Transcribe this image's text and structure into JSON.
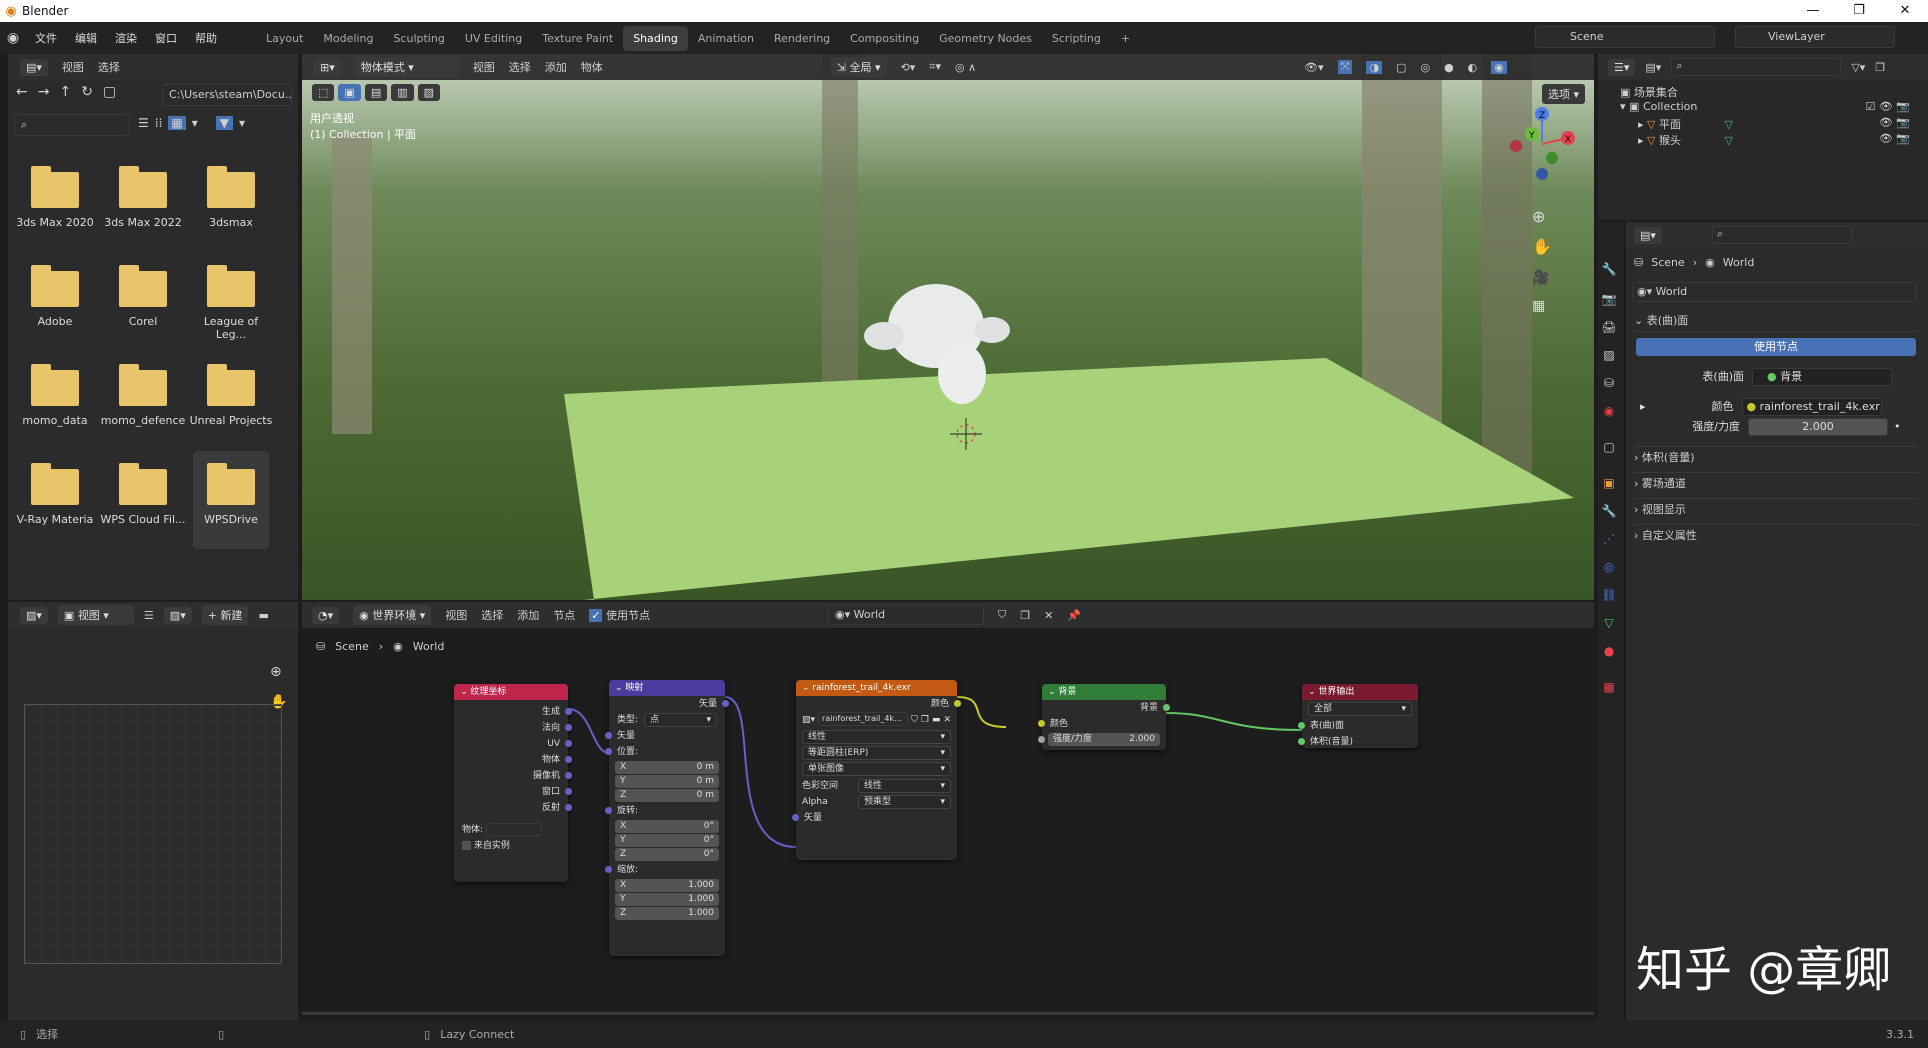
{
  "app": {
    "title": "Blender",
    "version": "3.3.1"
  },
  "window_controls": {
    "min": "—",
    "max": "❐",
    "close": "✕"
  },
  "menu": [
    "文件",
    "编辑",
    "渲染",
    "窗口",
    "帮助"
  ],
  "workspaces": [
    "Layout",
    "Modeling",
    "Sculpting",
    "UV Editing",
    "Texture Paint",
    "Shading",
    "Animation",
    "Rendering",
    "Compositing",
    "Geometry Nodes",
    "Scripting"
  ],
  "active_workspace": "Shading",
  "scene": {
    "name": "Scene",
    "view_layer": "ViewLayer"
  },
  "file_browser": {
    "header": {
      "view": "视图",
      "select": "选择"
    },
    "path": "C:\\Users\\steam\\Docu...",
    "folders": [
      "3ds Max 2020",
      "3ds Max 2022",
      "3dsmax",
      "Adobe",
      "Corel",
      "League of Leg...",
      "momo_data",
      "momo_defence",
      "Unreal Projects",
      "V-Ray Materia",
      "WPS Cloud Fil...",
      "WPSDrive"
    ]
  },
  "viewport": {
    "mode": "物体模式",
    "menus": [
      "视图",
      "选择",
      "添加",
      "物体"
    ],
    "transform": "全局",
    "options": "选项",
    "overlay_title": "用户透视",
    "overlay_sub": "(1) Collection | 平面"
  },
  "outliner": {
    "root": "场景集合",
    "collection": "Collection",
    "items": [
      "平面",
      "猴头"
    ]
  },
  "properties": {
    "breadcrumb": [
      "Scene",
      "World"
    ],
    "world_name": "World",
    "surface_panel": "表(曲)面",
    "use_nodes": "使用节点",
    "surface_label": "表(曲)面",
    "surface_value": "背景",
    "color_label": "颜色",
    "color_value": "rainforest_trail_4k.exr",
    "strength_label": "强度/力度",
    "strength_value": "2.000",
    "panels": [
      "体积(音量)",
      "雾场通道",
      "视图显示",
      "自定义属性"
    ]
  },
  "image_editor": {
    "view": "视图",
    "new": "新建"
  },
  "node_editor": {
    "type": "世界环境",
    "menus": [
      "视图",
      "选择",
      "添加",
      "节点"
    ],
    "use_nodes": "使用节点",
    "world": "World",
    "breadcrumb": [
      "Scene",
      "World"
    ],
    "nodes": {
      "texcoord": {
        "title": "纹理坐标",
        "outputs": [
          "生成",
          "法向",
          "UV",
          "物体",
          "摄像机",
          "窗口",
          "反射"
        ],
        "object_label": "物体:",
        "from_instancer": "来自实例"
      },
      "mapping": {
        "title": "映射",
        "output": "矢量",
        "type_label": "类型:",
        "type_value": "点",
        "vector": "矢量",
        "location": "位置:",
        "rotation": "旋转:",
        "scale": "缩放:",
        "loc": [
          [
            "X",
            "0 m"
          ],
          [
            "Y",
            "0 m"
          ],
          [
            "Z",
            "0 m"
          ]
        ],
        "rot": [
          [
            "X",
            "0°"
          ],
          [
            "Y",
            "0°"
          ],
          [
            "Z",
            "0°"
          ]
        ],
        "scl": [
          [
            "X",
            "1.000"
          ],
          [
            "Y",
            "1.000"
          ],
          [
            "Z",
            "1.000"
          ]
        ]
      },
      "envtex": {
        "title": "rainforest_trail_4k.exr",
        "output": "颜色",
        "image": "rainforest_trail_4k...",
        "interp": "线性",
        "projection": "等距圆柱(ERP)",
        "source": "单张图像",
        "cs_label": "色彩空间",
        "cs_value": "线性",
        "alpha_label": "Alpha",
        "alpha_value": "预乘型",
        "vector": "矢量"
      },
      "background": {
        "title": "背景",
        "output": "背景",
        "color": "颜色",
        "strength_label": "强度/力度",
        "strength_value": "2.000"
      },
      "output": {
        "title": "世界输出",
        "target": "全部",
        "surface": "表(曲)面",
        "volume": "体积(音量)"
      }
    }
  },
  "status_bar": {
    "select": "选择",
    "lazy_connect": "Lazy Connect"
  },
  "watermark": "知乎 @章卿",
  "colors": {
    "accent": "#4772b3",
    "green_plane": "#a8d27a",
    "texcoord_hdr": "#c0264c",
    "mapping_hdr": "#4b3d9e",
    "envtex_hdr": "#c25a14",
    "bg_hdr": "#2f7d37",
    "output_hdr": "#7a1a2f"
  }
}
